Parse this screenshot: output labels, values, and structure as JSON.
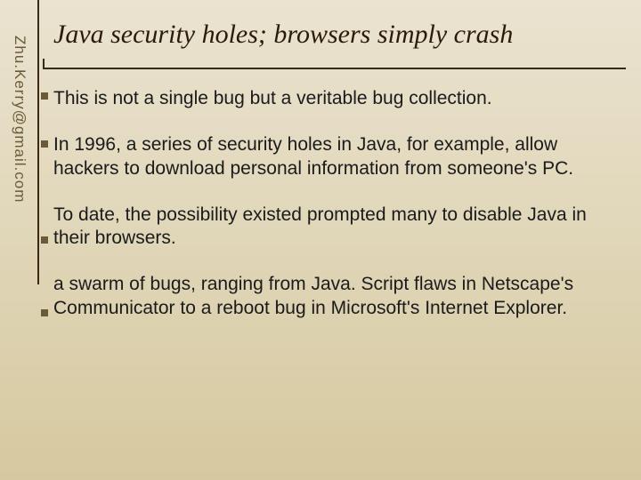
{
  "sidebar": {
    "email": "Zhu.Kerry@gmail.com"
  },
  "title": "Java security holes; browsers simply crash",
  "paragraphs": [
    "This is not a single bug but a veritable bug collection.",
    "In 1996, a series of security holes in Java, for example, allow hackers to download personal information from someone's  PC.",
    "To date, the possibility existed prompted many to disable Java in their browsers.",
    "a swarm of bugs, ranging from Java. Script flaws in Netscape's Communicator to a  reboot bug in Microsoft's Internet Explorer."
  ]
}
